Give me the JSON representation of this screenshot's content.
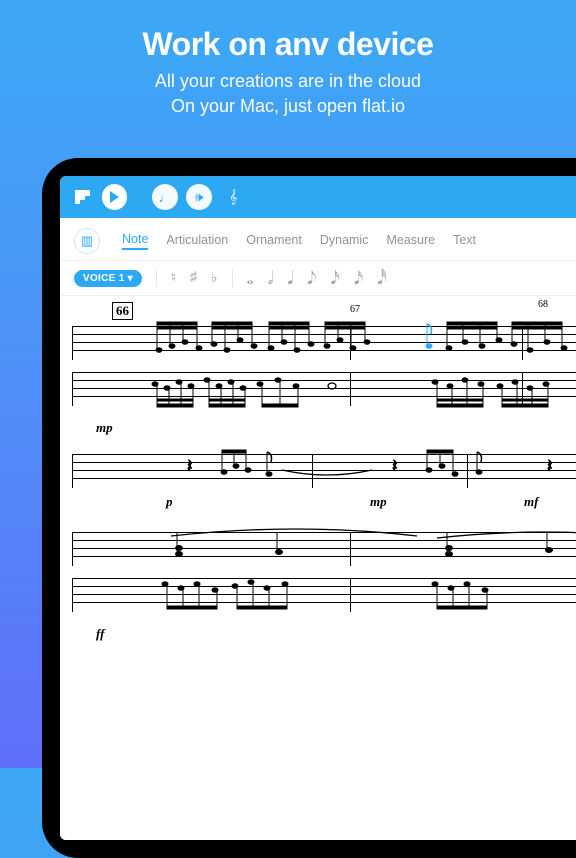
{
  "hero": {
    "title": "Work on anv device",
    "line1": "All your creations are in the cloud",
    "line2": "On your Mac, just open flat.io"
  },
  "topbar": {
    "play": "Play"
  },
  "tabs": {
    "note": "Note",
    "articulation": "Articulation",
    "ornament": "Ornament",
    "dynamic": "Dynamic",
    "measure": "Measure",
    "text": "Text"
  },
  "subtoolbar": {
    "voice_label": "VOICE 1",
    "accidentals": [
      "♮",
      "♯",
      "♭"
    ],
    "durations": [
      "𝅝",
      "𝅗𝅥",
      "𝅘𝅥",
      "𝅘𝅥𝅮",
      "𝅘𝅥𝅯",
      "𝅘𝅥𝅯",
      "𝅘𝅥𝅰"
    ]
  },
  "score": {
    "rehearsal": "66",
    "measure_numbers": [
      "67",
      "68"
    ],
    "dynamics": [
      "mp",
      "p",
      "mp",
      "mf",
      "ff"
    ]
  },
  "colors": {
    "accent": "#2da9f4"
  }
}
